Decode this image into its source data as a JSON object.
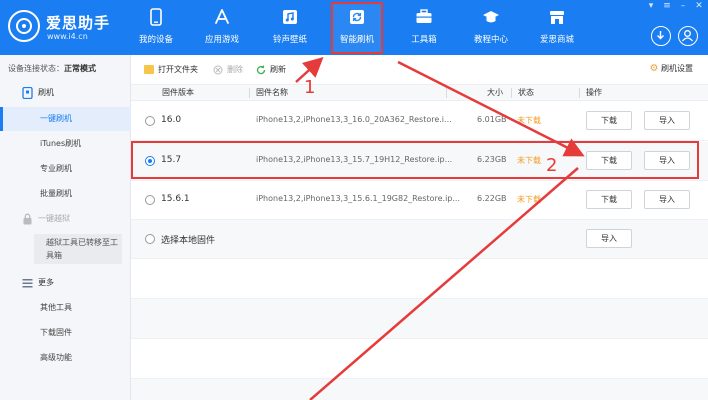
{
  "app": {
    "name": "爱思助手",
    "url": "www.i4.cn"
  },
  "nav": [
    {
      "label": "我的设备",
      "icon": "phone-icon"
    },
    {
      "label": "应用游戏",
      "icon": "app-store-icon"
    },
    {
      "label": "铃声壁纸",
      "icon": "music-icon"
    },
    {
      "label": "智能刷机",
      "icon": "refresh-icon"
    },
    {
      "label": "工具箱",
      "icon": "toolbox-icon"
    },
    {
      "label": "教程中心",
      "icon": "graduation-cap-icon"
    },
    {
      "label": "爱思商城",
      "icon": "shop-icon"
    }
  ],
  "sidebar": {
    "status_label": "设备连接状态：",
    "status_value": "正常模式",
    "flash_head": "刷机",
    "items": [
      {
        "label": "一键刷机"
      },
      {
        "label": "iTunes刷机"
      },
      {
        "label": "专业刷机"
      },
      {
        "label": "批量刷机"
      }
    ],
    "jailbreak_head": "一键越狱",
    "jailbreak_note": "越狱工具已转移至工具箱",
    "more_head": "更多",
    "more_items": [
      {
        "label": "其他工具"
      },
      {
        "label": "下载固件"
      },
      {
        "label": "高级功能"
      }
    ]
  },
  "toolbar": {
    "open_folder": "打开文件夹",
    "delete": "删除",
    "refresh": "刷新",
    "settings": "刷机设置"
  },
  "table": {
    "headers": {
      "version": "固件版本",
      "name": "固件名称",
      "size": "大小",
      "status": "状态",
      "action": "操作"
    },
    "rows": [
      {
        "version": "16.0",
        "name": "iPhone13,2,iPhone13,3_16.0_20A362_Restore.i...",
        "size": "6.01GB",
        "status": "未下载",
        "download": "下载",
        "import": "导入"
      },
      {
        "version": "15.7",
        "name": "iPhone13,2,iPhone13,3_15.7_19H12_Restore.ip...",
        "size": "6.23GB",
        "status": "未下载",
        "download": "下载",
        "import": "导入"
      },
      {
        "version": "15.6.1",
        "name": "iPhone13,2,iPhone13,3_15.6.1_19G82_Restore.ip...",
        "size": "6.22GB",
        "status": "未下载",
        "download": "下载",
        "import": "导入"
      }
    ],
    "local": {
      "label": "选择本地固件",
      "import": "导入"
    }
  },
  "annotations": {
    "one": "1",
    "two": "2"
  },
  "colors": {
    "brand": "#1a7df1",
    "annotation": "#e53b3b",
    "status": "#f39a1f"
  }
}
